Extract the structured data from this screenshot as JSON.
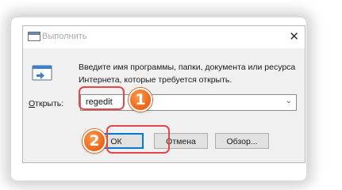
{
  "window": {
    "title": "Выполнить",
    "close_glyph": "✕"
  },
  "description": {
    "line1": "Введите имя программы, папки, документа или ресурса",
    "line2": "Интернета, которые требуется открыть."
  },
  "open_field": {
    "label_underlined": "О",
    "label_rest": "ткрыть:",
    "value": "regedit",
    "chevron_glyph": "⌄"
  },
  "buttons": {
    "ok": "ОК",
    "cancel": "Отмена",
    "browse": "Обзор..."
  },
  "annotations": {
    "step1": "1",
    "step2": "2"
  },
  "colors": {
    "highlight": "#e24a4a",
    "badge": "#ef6b1f",
    "default_button_border": "#0078d7"
  },
  "icons": [
    "run-app-icon",
    "run-dialog-icon",
    "close-icon",
    "chevron-down-icon"
  ]
}
